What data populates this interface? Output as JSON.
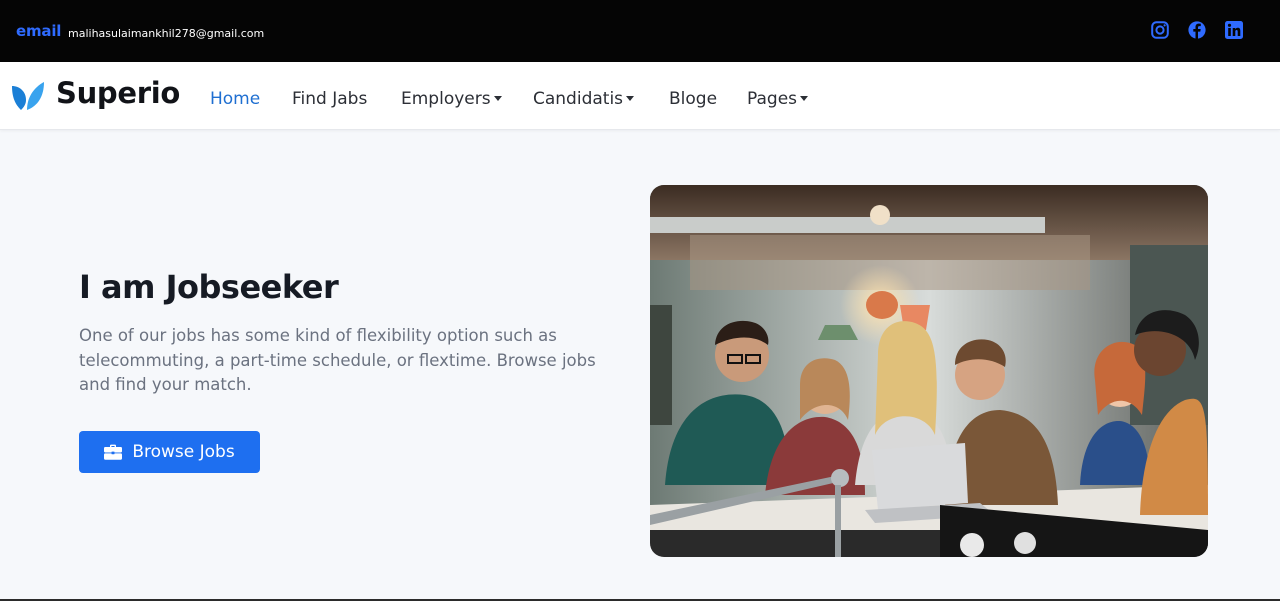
{
  "topbar": {
    "email_label": "email",
    "email_value": "malihasulaimankhil278@gmail.com",
    "social": [
      "instagram-icon",
      "facebook-icon",
      "linkedin-icon"
    ],
    "accent": "#2f6bff"
  },
  "navbar": {
    "brand": "Superio",
    "items": [
      {
        "label": "Home",
        "active": true,
        "dropdown": false
      },
      {
        "label": "Find Jabs",
        "active": false,
        "dropdown": false
      },
      {
        "label": "Employers",
        "active": false,
        "dropdown": true
      },
      {
        "label": "Candidatis",
        "active": false,
        "dropdown": true
      },
      {
        "label": "Bloge",
        "active": false,
        "dropdown": false
      },
      {
        "label": "Pages",
        "active": false,
        "dropdown": true
      }
    ],
    "active_color": "#1f6fd1"
  },
  "hero": {
    "title": "I am Jobseeker",
    "description": "One of our jobs has some kind of flexibility option such as telecommuting, a part-time schedule, or flextime. Browse jobs and find your match.",
    "button_label": "Browse Jobs",
    "button_icon": "briefcase-icon",
    "button_color": "#1e6ff0"
  }
}
